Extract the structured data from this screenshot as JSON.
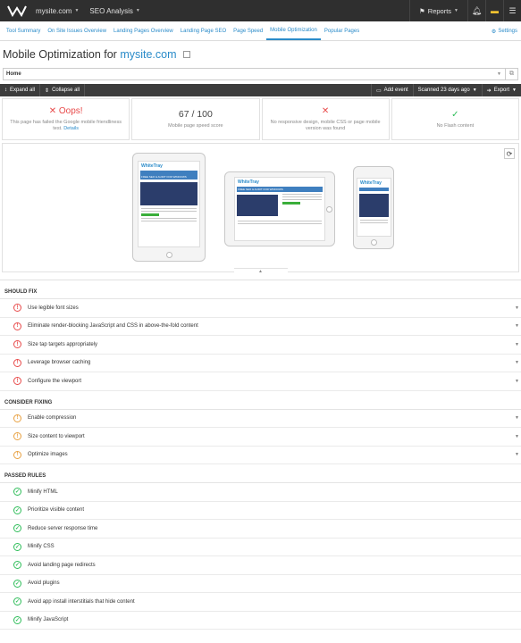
{
  "topbar": {
    "site": "mysite.com",
    "tool": "SEO Analysis",
    "reports": "Reports"
  },
  "nav": {
    "tabs": [
      "Tool Summary",
      "On Site Issues Overview",
      "Landing Pages Overview",
      "Landing Page SEO",
      "Page Speed",
      "Mobile Optimization",
      "Popular Pages"
    ],
    "active_tab": "Mobile Optimization",
    "settings": "Settings"
  },
  "page": {
    "title_prefix": "Mobile Optimization for",
    "title_site": "mysite.com",
    "page_select": "Home"
  },
  "toolbar": {
    "expand_all": "Expand all",
    "collapse_all": "Collapse all",
    "add_event": "Add event",
    "scanned": "Scanned 23 days ago",
    "export": "Export"
  },
  "cards": [
    {
      "status": "Oops!",
      "text": "This page has failed the Google mobile friendliness test.",
      "link": "Details"
    },
    {
      "status": "67 / 100",
      "text": "Mobile page speed score"
    },
    {
      "status": "✕",
      "text": "No responsive design, mobile CSS or page mobile version was found"
    },
    {
      "status": "✓",
      "text": "No Flash content"
    }
  ],
  "sections": {
    "should_fix": {
      "title": "SHOULD FIX",
      "items": [
        "Use legible font sizes",
        "Eliminate render-blocking JavaScript and CSS in above-the-fold content",
        "Size tap targets appropriately",
        "Leverage browser caching",
        "Configure the viewport"
      ]
    },
    "consider_fixing": {
      "title": "CONSIDER FIXING",
      "items": [
        "Enable compression",
        "Size content to viewport",
        "Optimize images"
      ]
    },
    "passed": {
      "title": "PASSED RULES",
      "items": [
        "Minify HTML",
        "Prioritize visible content",
        "Reduce server response time",
        "Minify CSS",
        "Avoid landing page redirects",
        "Avoid plugins",
        "Avoid app install interstitials that hide content",
        "Minify JavaScript"
      ]
    }
  },
  "preview": {
    "logo_text": "WhiteTray",
    "banner_text": "FREE SEO & AUDIT FOR WINDOWS"
  },
  "colors": {
    "accent": "#2a8bc9",
    "error": "#e84a4a",
    "warning": "#e8a040",
    "pass": "#2ebd59",
    "topbar": "#2f2f2f"
  }
}
